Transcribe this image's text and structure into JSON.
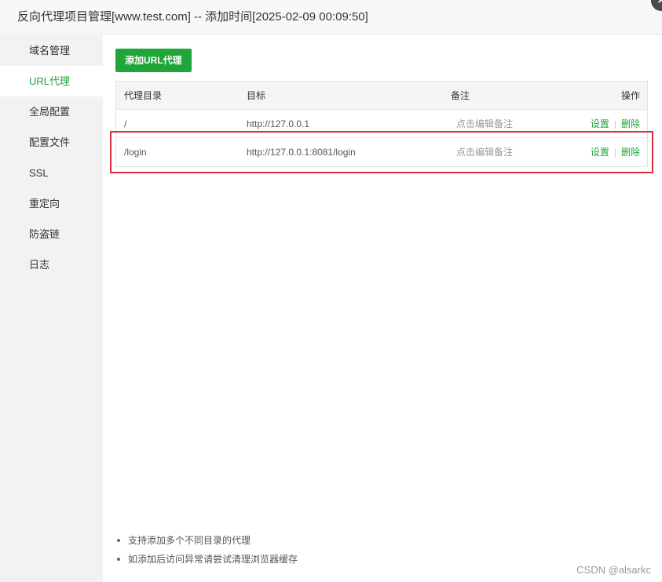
{
  "title": "反向代理项目管理[www.test.com] -- 添加时间[2025-02-09 00:09:50]",
  "close_icon": "×",
  "sidebar": {
    "items": [
      {
        "label": "域名管理"
      },
      {
        "label": "URL代理",
        "active": true
      },
      {
        "label": "全局配置"
      },
      {
        "label": "配置文件"
      },
      {
        "label": "SSL"
      },
      {
        "label": "重定向"
      },
      {
        "label": "防盗链"
      },
      {
        "label": "日志"
      }
    ]
  },
  "main": {
    "add_button": "添加URL代理",
    "table": {
      "headers": {
        "dir": "代理目录",
        "target": "目标",
        "note": "备注",
        "ops": "操作"
      },
      "rows": [
        {
          "dir": "/",
          "target": "http://127.0.0.1",
          "note": "点击编辑备注",
          "settings": "设置",
          "sep": "|",
          "delete": "删除"
        },
        {
          "dir": "/login",
          "target": "http://127.0.0.1:8081/login",
          "note": "点击编辑备注",
          "settings": "设置",
          "sep": "|",
          "delete": "删除"
        }
      ]
    },
    "tips": [
      "支持添加多个不同目录的代理",
      "如添加后访问异常请尝试清理浏览器缓存"
    ]
  },
  "watermark": "CSDN @alsarkc",
  "colors": {
    "accent": "#20a53a",
    "highlight": "#d9303a"
  }
}
